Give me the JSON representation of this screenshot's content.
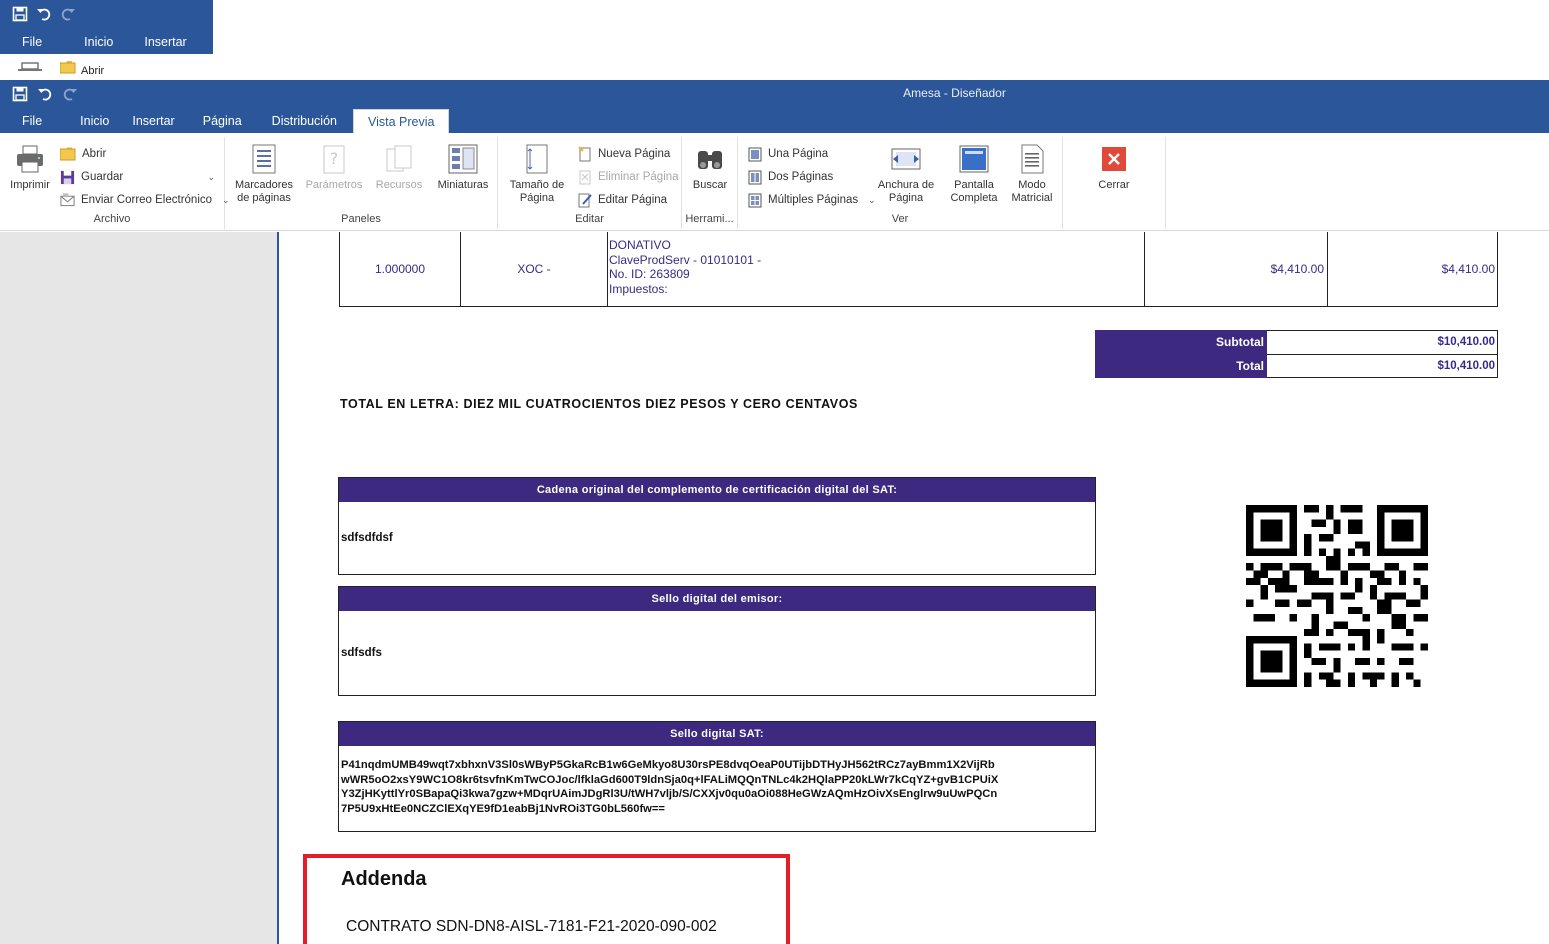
{
  "ghost": {
    "tabs": [
      "File",
      "Inicio",
      "Insertar"
    ],
    "open_label": "Abrir"
  },
  "window": {
    "title": "Amesa - Diseñador"
  },
  "tabs": [
    {
      "label": "File",
      "active": false
    },
    {
      "label": "Inicio",
      "active": false
    },
    {
      "label": "Insertar",
      "active": false
    },
    {
      "label": "Página",
      "active": false
    },
    {
      "label": "Distribución",
      "active": false
    },
    {
      "label": "Vista Previa",
      "active": true
    }
  ],
  "ribbon": {
    "archivo": {
      "label": "Archivo",
      "imprimir": "Imprimir",
      "abrir": "Abrir",
      "guardar": "Guardar",
      "enviar": "Enviar Correo Electrónico"
    },
    "paneles": {
      "label": "Paneles",
      "marcadores": "Marcadores de páginas",
      "parametros": "Parámetros",
      "recursos": "Recursos",
      "miniaturas": "Miniaturas"
    },
    "editar": {
      "label": "Editar",
      "tamano": "Tamaño de Página",
      "nueva": "Nueva Página",
      "eliminar": "Eliminar Página",
      "editar": "Editar Página"
    },
    "herramientas": {
      "label": "Herrami...",
      "buscar": "Buscar"
    },
    "ver": {
      "label": "Ver",
      "una": "Una Página",
      "dos": "Dos Páginas",
      "multiples": "Múltiples Páginas",
      "anchura": "Anchura de Página",
      "pantalla": "Pantalla Completa",
      "modo": "Modo Matricial"
    },
    "cerrar": {
      "label": "Cerrar"
    }
  },
  "document": {
    "item": {
      "cantidad": "1.000000",
      "unidad": "XOC -",
      "descripcion": [
        "DONATIVO",
        "ClaveProdServ - 01010101 -",
        "No. ID: 263809",
        "Impuestos:"
      ],
      "precio": "$4,410.00",
      "importe": "$4,410.00"
    },
    "totals": [
      {
        "label": "Subtotal",
        "value": "$10,410.00"
      },
      {
        "label": "Total",
        "value": "$10,410.00"
      }
    ],
    "total_letra": "TOTAL EN LETRA: DIEZ MIL CUATROCIENTOS DIEZ PESOS Y CERO CENTAVOS",
    "cadena": {
      "title": "Cadena original del complemento de certificación digital del SAT:",
      "value": "sdfsdfdsf"
    },
    "sello_emisor": {
      "title": "Sello digital del emisor:",
      "value": "sdfsdfs"
    },
    "sello_sat": {
      "title": "Sello digital SAT:",
      "lines": [
        "P41nqdmUMB49wqt7xbhxnV3Sl0sWByP5GkaRcB1w6GeMkyo8U30rsPE8dvqOeaP0UTijbDTHyJH562tRCz7ayBmm1X2VijRb",
        "wWR5oO2xsY9WC1O8kr6tsvfnKmTwCOJoc/lfklaGd600T9ldnSja0q+lFALiMQQnTNLc4k2HQlaPP20kLWr7kCqYZ+gvB1CPUiX",
        "Y3ZjHKyttlYr0SBapaQi3kwa7gzw+MDqrUAimJDgRl3U/tWH7vljb/S/CXXjv0qu0aOi088HeGWzAQmHzOivXsEnglrw9uUwPQCn",
        "7P5U9xHtEe0NCZClEXqYE9fD1eabBj1NvROi3TG0bL560fw=="
      ]
    },
    "addenda": {
      "title": "Addenda",
      "text": "CONTRATO SDN-DN8-AISL-7181-F21-2020-090-002"
    }
  },
  "colors": {
    "ribbon_blue": "#2b579a",
    "header_purple": "#3d2a80",
    "text_purple": "#3a2a85",
    "highlight_red": "#e21f26"
  }
}
